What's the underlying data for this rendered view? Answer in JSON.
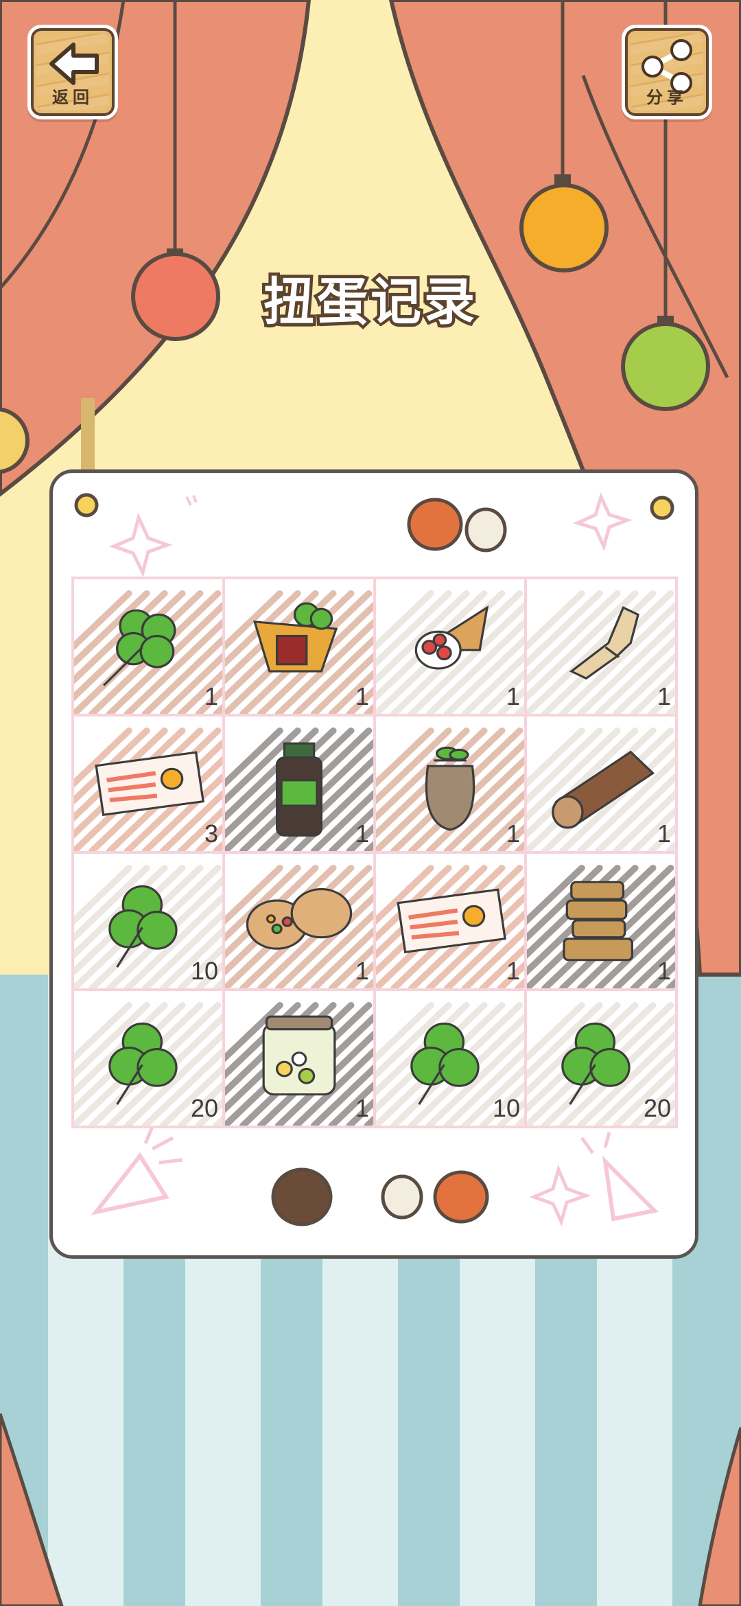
{
  "header": {
    "back_label": "返回",
    "back_icon": "arrow-left-icon",
    "share_label": "分享",
    "share_icon": "share-icon",
    "title": "扭蛋记录"
  },
  "colors": {
    "curtain": "#e98f74",
    "wall": "#fdeeb4",
    "floor_stripe_dark": "#a7d1d4",
    "floor_stripe_light": "#e0eff0",
    "lamp_red": "#ef7a63",
    "lamp_orange": "#f6ad2c",
    "lamp_green": "#a6cc4c",
    "board_outline": "#5a5452",
    "grid_line": "#f7d3dc"
  },
  "records": [
    {
      "item": "four-leaf-clover",
      "count": "1"
    },
    {
      "item": "vegetable-wrap",
      "count": "1"
    },
    {
      "item": "strawberry-crepe",
      "count": "1"
    },
    {
      "item": "straw-bundle",
      "count": "1"
    },
    {
      "item": "lucky-ticket",
      "count": "3"
    },
    {
      "item": "medicine-bottle",
      "count": "1"
    },
    {
      "item": "seed-bag",
      "count": "1"
    },
    {
      "item": "log",
      "count": "1"
    },
    {
      "item": "clover",
      "count": "10"
    },
    {
      "item": "pita-bread",
      "count": "1"
    },
    {
      "item": "lucky-ticket",
      "count": "1"
    },
    {
      "item": "stacked-pancakes",
      "count": "1"
    },
    {
      "item": "clover",
      "count": "20"
    },
    {
      "item": "candy-jar",
      "count": "1"
    },
    {
      "item": "clover",
      "count": "10"
    },
    {
      "item": "clover",
      "count": "20"
    }
  ]
}
